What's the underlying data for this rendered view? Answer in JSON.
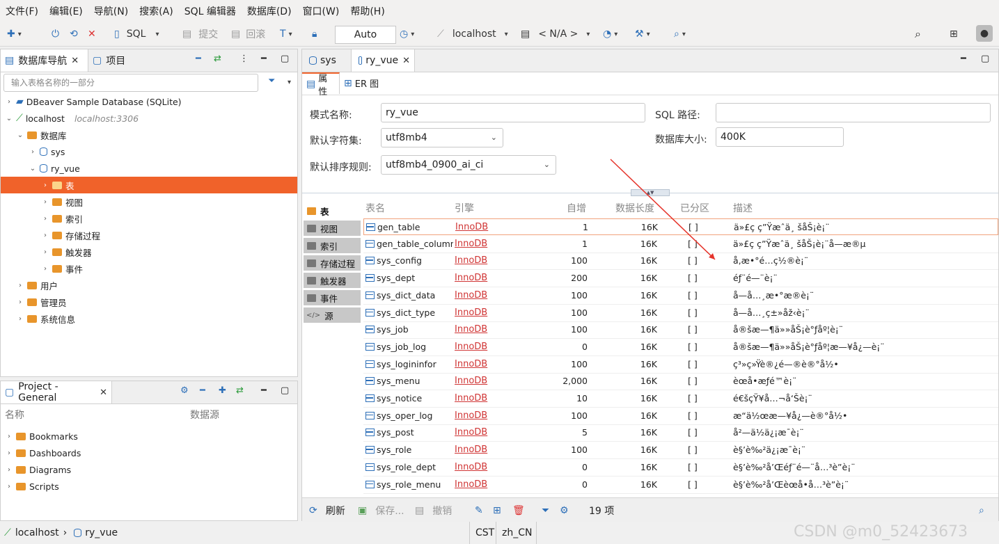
{
  "menu": [
    "文件(F)",
    "编辑(E)",
    "导航(N)",
    "搜索(A)",
    "SQL 编辑器",
    "数据库(D)",
    "窗口(W)",
    "帮助(H)"
  ],
  "toolbar": {
    "sql": "SQL",
    "commit": "提交",
    "rollback": "回滚",
    "mode": "Auto",
    "connection": "localhost",
    "schema": "< N/A >"
  },
  "nav": {
    "tab_title": "数据库导航",
    "tab_project": "项目",
    "filter_placeholder": "输入表格名称的一部分",
    "tree": [
      {
        "label": "DBeaver Sample Database (SQLite)",
        "sub": ""
      },
      {
        "label": "localhost",
        "sub": "localhost:3306"
      },
      {
        "label": "数据库",
        "sub": ""
      },
      {
        "label": "sys",
        "sub": ""
      },
      {
        "label": "ry_vue",
        "sub": ""
      },
      {
        "label": "表",
        "sub": ""
      },
      {
        "label": "视图",
        "sub": ""
      },
      {
        "label": "索引",
        "sub": ""
      },
      {
        "label": "存储过程",
        "sub": ""
      },
      {
        "label": "触发器",
        "sub": ""
      },
      {
        "label": "事件",
        "sub": ""
      },
      {
        "label": "用户",
        "sub": ""
      },
      {
        "label": "管理员",
        "sub": ""
      },
      {
        "label": "系统信息",
        "sub": ""
      }
    ]
  },
  "project": {
    "title": "Project - General",
    "col_name": "名称",
    "col_source": "数据源",
    "items": [
      "Bookmarks",
      "Dashboards",
      "Diagrams",
      "Scripts"
    ]
  },
  "editor": {
    "tabs": [
      "sys",
      "ry_vue"
    ],
    "subtabs": [
      "属性",
      "ER 图"
    ],
    "schema_name_label": "模式名称:",
    "schema_name": "ry_vue",
    "sql_path_label": "SQL 路径:",
    "sql_path": "",
    "charset_label": "默认字符集:",
    "charset": "utf8mb4",
    "db_size_label": "数据库大小:",
    "db_size": "400K",
    "collation_label": "默认排序规则:",
    "collation": "utf8mb4_0900_ai_ci",
    "side": [
      "表",
      "视图",
      "索引",
      "存储过程",
      "触发器",
      "事件",
      "源"
    ],
    "columns": [
      "表名",
      "引擎",
      "自增",
      "数据长度",
      "已分区",
      "描述"
    ],
    "rows": [
      {
        "name": "gen_table",
        "engine": "InnoDB",
        "auto": "1",
        "len": "16K",
        "part": "[ ]",
        "desc": "ä»£ç ç”Ÿæˆä¸ šåŠ¡è¡¨"
      },
      {
        "name": "gen_table_column",
        "engine": "InnoDB",
        "auto": "1",
        "len": "16K",
        "part": "[ ]",
        "desc": "ä»£ç ç”Ÿæˆä¸ šåŠ¡è¡¨å—æ®µ"
      },
      {
        "name": "sys_config",
        "engine": "InnoDB",
        "auto": "100",
        "len": "16K",
        "part": "[ ]",
        "desc": "å‚æ•°é…ç½®è¡¨"
      },
      {
        "name": "sys_dept",
        "engine": "InnoDB",
        "auto": "200",
        "len": "16K",
        "part": "[ ]",
        "desc": "éƒ¨é—¨è¡¨"
      },
      {
        "name": "sys_dict_data",
        "engine": "InnoDB",
        "auto": "100",
        "len": "16K",
        "part": "[ ]",
        "desc": "å—å…¸æ•°æ®è¡¨"
      },
      {
        "name": "sys_dict_type",
        "engine": "InnoDB",
        "auto": "100",
        "len": "16K",
        "part": "[ ]",
        "desc": "å—å…¸ç±»åž‹è¡¨"
      },
      {
        "name": "sys_job",
        "engine": "InnoDB",
        "auto": "100",
        "len": "16K",
        "part": "[ ]",
        "desc": "å®šæ—¶ä»»åŠ¡è°ƒåº¦è¡¨"
      },
      {
        "name": "sys_job_log",
        "engine": "InnoDB",
        "auto": "0",
        "len": "16K",
        "part": "[ ]",
        "desc": "å®šæ—¶ä»»åŠ¡è°ƒåº¦æ—¥å¿—è¡¨"
      },
      {
        "name": "sys_logininfor",
        "engine": "InnoDB",
        "auto": "100",
        "len": "16K",
        "part": "[ ]",
        "desc": "ç³»ç»Ÿè®¿é—®è®°å½•"
      },
      {
        "name": "sys_menu",
        "engine": "InnoDB",
        "auto": "2,000",
        "len": "16K",
        "part": "[ ]",
        "desc": "èœå•æƒé™è¡¨"
      },
      {
        "name": "sys_notice",
        "engine": "InnoDB",
        "auto": "10",
        "len": "16K",
        "part": "[ ]",
        "desc": "é€šçŸ¥å…¬å‘Šè¡¨"
      },
      {
        "name": "sys_oper_log",
        "engine": "InnoDB",
        "auto": "100",
        "len": "16K",
        "part": "[ ]",
        "desc": "æ“ä½œæ—¥å¿—è®°å½•"
      },
      {
        "name": "sys_post",
        "engine": "InnoDB",
        "auto": "5",
        "len": "16K",
        "part": "[ ]",
        "desc": "å²—ä½ä¿¡æ¯è¡¨"
      },
      {
        "name": "sys_role",
        "engine": "InnoDB",
        "auto": "100",
        "len": "16K",
        "part": "[ ]",
        "desc": "è§’è‰²ä¿¡æ¯è¡¨"
      },
      {
        "name": "sys_role_dept",
        "engine": "InnoDB",
        "auto": "0",
        "len": "16K",
        "part": "[ ]",
        "desc": "è§’è‰²å’Œéƒ¨é—¨å…³è”è¡¨"
      },
      {
        "name": "sys_role_menu",
        "engine": "InnoDB",
        "auto": "0",
        "len": "16K",
        "part": "[ ]",
        "desc": "è§’è‰²å’Œèœå•å…³è”è¡¨"
      }
    ],
    "bottom": {
      "refresh": "刷新",
      "save": "保存...",
      "cancel": "撤销",
      "count": "19 项"
    }
  },
  "status": {
    "connection": "localhost",
    "schema": "ry_vue",
    "tz": "CST",
    "locale": "zh_CN"
  },
  "watermark": "CSDN @m0_52423673",
  "colors": {
    "selection": "#f0622a",
    "accent": "#2d6fb8",
    "engine_link": "#d03434",
    "arrow": "#e5332a"
  }
}
